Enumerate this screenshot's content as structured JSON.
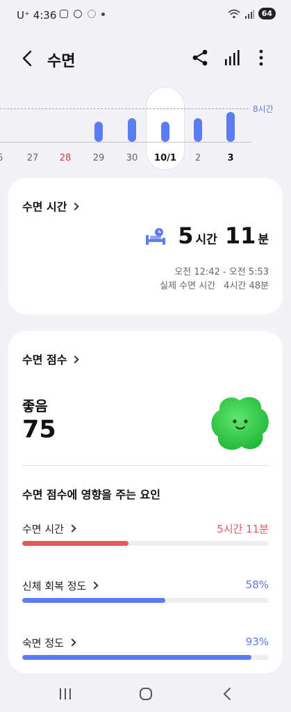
{
  "status_bar": {
    "carrier": "U⁺",
    "time": "4:36",
    "battery": "64"
  },
  "app_bar": {
    "title": "수면"
  },
  "date_strip": {
    "goal_label": "8시간",
    "selected_date": "10/1",
    "days": [
      {
        "label": "6",
        "color": "normal"
      },
      {
        "label": "27",
        "color": "normal"
      },
      {
        "label": "28",
        "color": "red"
      },
      {
        "label": "29",
        "color": "normal",
        "bar_value": 0.36
      },
      {
        "label": "30",
        "color": "normal",
        "bar_value": 0.42
      },
      {
        "label": "10/1",
        "color": "bold",
        "bar_value": 0.36
      },
      {
        "label": "2",
        "color": "normal",
        "bar_value": 0.42
      },
      {
        "label": "3",
        "color": "bold",
        "bar_value": 0.54
      }
    ]
  },
  "sleep_time_card": {
    "title": "수면 시간",
    "hours": "5",
    "hours_unit": "시간",
    "minutes": "11",
    "minutes_unit": "분",
    "range": "오전 12:42 - 오전 5:53",
    "actual_label": "실제 수면 시간",
    "actual_value": "4시간 48분"
  },
  "sleep_score_card": {
    "title": "수면 점수",
    "rating": "좋음",
    "score": "75",
    "factors_title": "수면 점수에 영향을 주는 요인",
    "factors": [
      {
        "label": "수면 시간",
        "value": "5시간 11분",
        "fraction": 0.43,
        "color": "#e8555a"
      },
      {
        "label": "신체 회복 정도",
        "value": "58%",
        "fraction": 0.58,
        "color": "#5c7cf2"
      },
      {
        "label": "숙면 정도",
        "value": "93%",
        "fraction": 0.93,
        "color": "#5c7cf2"
      }
    ]
  },
  "colors": {
    "accent": "#5c7cf2",
    "warning": "#d8413a",
    "mascot": "#3ad14c"
  }
}
